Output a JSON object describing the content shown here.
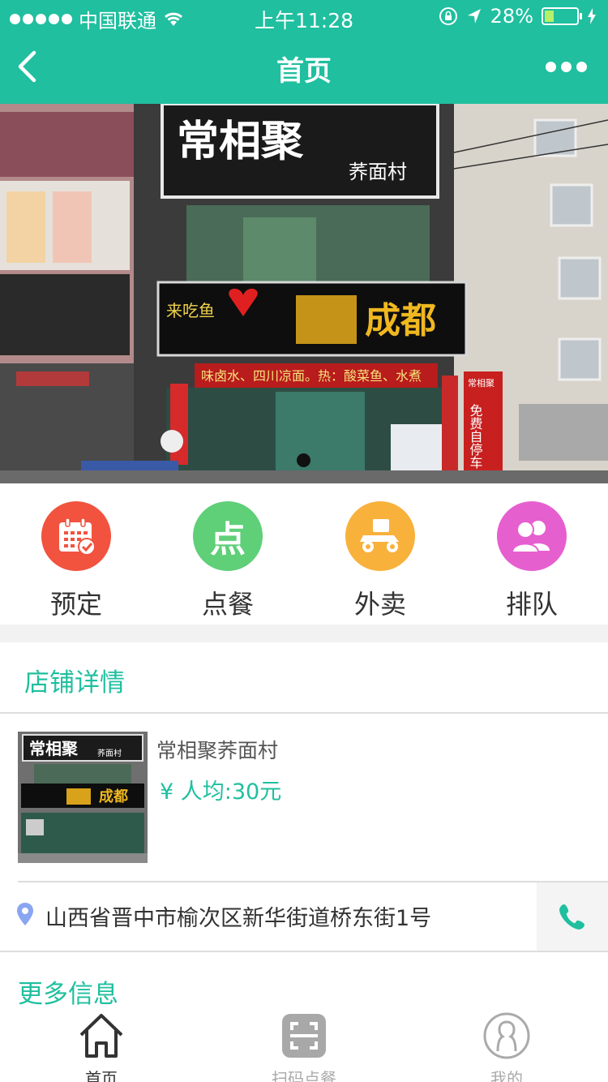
{
  "status_bar": {
    "carrier": "中国联通",
    "time": "上午11:28",
    "battery": "28%",
    "battery_level": 0.28
  },
  "nav": {
    "title": "首页"
  },
  "banner": {
    "sign_main": "常相聚",
    "sign_sub": "荞面村",
    "sign_chengdu": "成都",
    "sign_laichiyu": "来吃鱼",
    "ribbon_text": "味卤水、四川凉面。热：酸菜鱼、水煮",
    "side_sign": "免费自停车",
    "side_sign_top": "常相聚",
    "indicator_active": 0
  },
  "actions": [
    {
      "label": "预定",
      "icon": "calendar-icon",
      "color": "#f1533f"
    },
    {
      "label": "点餐",
      "icon": "order-icon",
      "icon_text": "点",
      "color": "#5fcf78"
    },
    {
      "label": "外卖",
      "icon": "delivery-scooter-icon",
      "color": "#f8b13b"
    },
    {
      "label": "排队",
      "icon": "queue-people-icon",
      "color": "#e65fcf"
    }
  ],
  "store": {
    "section_title": "店铺详情",
    "name": "常相聚荞面村",
    "price": "¥ 人均:30元",
    "address": "山西省晋中市榆次区新华街道桥东街1号",
    "thumb_sign": "常相聚",
    "thumb_sub": "荞面村",
    "thumb_chengdu": "成都",
    "more_info": "更多信息"
  },
  "tabbar": [
    {
      "label": "首页",
      "icon": "home-icon",
      "active": true
    },
    {
      "label": "扫码点餐",
      "icon": "scan-icon",
      "active": false
    },
    {
      "label": "我的",
      "icon": "profile-icon",
      "active": false
    }
  ],
  "colors": {
    "brand": "#1fbf9f",
    "tab_active": "#333333",
    "tab_inactive": "#aaaaaa"
  }
}
